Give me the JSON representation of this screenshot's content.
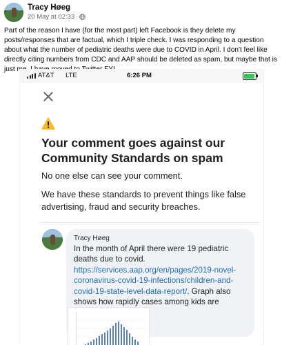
{
  "post": {
    "author": "Tracy Høeg",
    "date": "20 May at 02:33",
    "dot": "·",
    "text": "Part of the reason I have (for the most part) left Facebook is they delete my posts/responses that are factual, which I triple check. I was responding to a question about what the number of pediatric deaths were due to COVID in April. I don't feel like directly citing numbers from CDC and AAP should be deleted as spam, but maybe that is just me. I have moved to Twitter FYI."
  },
  "phone": {
    "status_bar": {
      "carrier": "AT&T",
      "network": "LTE",
      "time": "6:26 PM"
    },
    "notice": {
      "heading": "Your comment goes against our Community Standards on spam",
      "line1": "No one else can see your comment.",
      "line2": "We have these standards to prevent things like false advertising, fraud and security breaches."
    },
    "comment": {
      "author": "Tracy Høeg",
      "text_before": "In the month of April there were 19 pediatric deaths due to covid. ",
      "link": "https://services.aap.org/en/pages/2019-novel-coronavirus-covid-19-infections/children-and-covid-19-state-level-data-report/",
      "text_after": ". Graph also shows how rapidly cases among kids are declining."
    }
  },
  "colors": {
    "link": "#1d6fb8",
    "warning": "#f7b928",
    "bubble": "#f0f2f5",
    "battery": "#35c759"
  },
  "icons": [
    "globe-icon",
    "signal-icon",
    "battery-icon",
    "close-icon",
    "warning-icon"
  ]
}
